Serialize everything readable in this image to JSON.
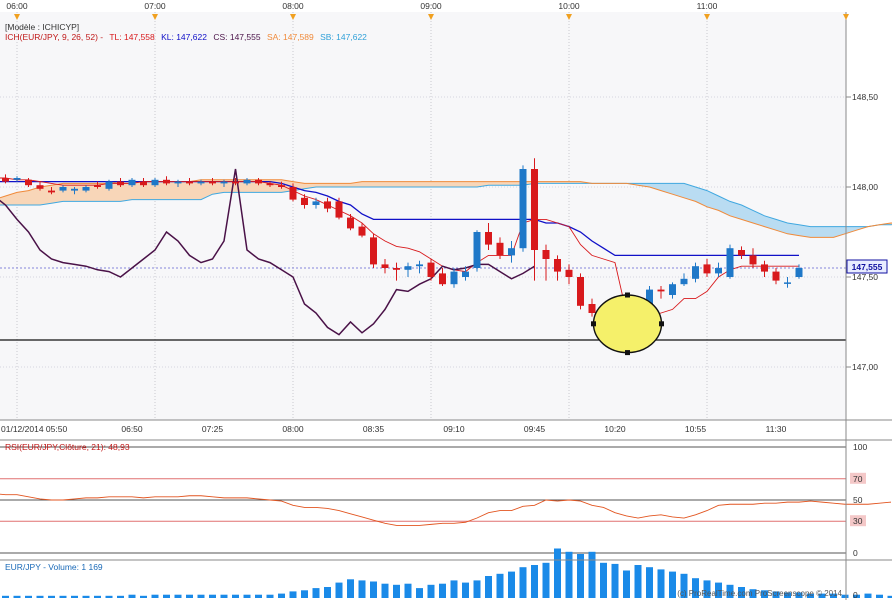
{
  "colors": {
    "bull": "#1f78c8",
    "bear": "#d8191c",
    "tenkan": "#d8191c",
    "kijun": "#1010c8",
    "chikou": "#4a1248",
    "senkou_a": "#f08a3a",
    "senkou_b": "#40a8e0",
    "kumo_fill": "#b9dcf2",
    "kumo_fill_alt": "#f8d6b8",
    "highlight": "#f5f06a",
    "rsi_line": "#e25520",
    "volume": "#1a8ae8",
    "last_price_tag": "#1010a0"
  },
  "price_panel": {
    "model_label": "[Modèle : ICHICYP]",
    "legend": {
      "prefix": "ICH(EUR/JPY, 9, 26, 52) -",
      "tl": "TL: 147,558",
      "kl": "KL: 147,622",
      "cs": "CS: 147,555",
      "sa": "SA: 147,589",
      "sb": "SB: 147,622"
    },
    "last_price_tag": "147,555"
  },
  "top_time_labels": [
    "06:00",
    "07:00",
    "08:00",
    "09:00",
    "10:00",
    "11:00"
  ],
  "bottom_time_labels": [
    "01/12/2014 05:50",
    "06:50",
    "07:25",
    "08:00",
    "08:35",
    "09:10",
    "09:45",
    "10:20",
    "10:55",
    "11:30"
  ],
  "rsi_panel": {
    "legend": "RSI(EUR/JPY,Clôture, 21): 48,93",
    "ticks": [
      "100",
      "70",
      "50",
      "30",
      "0"
    ]
  },
  "volume_panel": {
    "legend": "EUR/JPY - Volume: 1 169",
    "tick": "0",
    "watermark": "(c) ProRealTime.com ProScreenscope © 2014"
  },
  "chart_data": {
    "type": "candlestick",
    "instrument": "EUR/JPY",
    "timeframe_minutes": 5,
    "first_bar": "05:50",
    "last_bar": "11:35",
    "y_axis_ticks": [
      "148,50",
      "148,00",
      "147,50",
      "147,00"
    ],
    "ylim": [
      146.85,
      149.0
    ],
    "support_level": 147.15,
    "candles": [
      {
        "t": "05:50",
        "o": 148.04,
        "h": 148.07,
        "l": 148.02,
        "c": 148.06
      },
      {
        "t": "05:55",
        "o": 148.05,
        "h": 148.07,
        "l": 148.02,
        "c": 148.03
      },
      {
        "t": "06:00",
        "o": 148.04,
        "h": 148.06,
        "l": 148.03,
        "c": 148.05
      },
      {
        "t": "06:05",
        "o": 148.04,
        "h": 148.05,
        "l": 148.0,
        "c": 148.01
      },
      {
        "t": "06:10",
        "o": 148.01,
        "h": 148.03,
        "l": 147.98,
        "c": 147.99
      },
      {
        "t": "06:15",
        "o": 147.98,
        "h": 148.0,
        "l": 147.96,
        "c": 147.97
      },
      {
        "t": "06:20",
        "o": 147.98,
        "h": 148.01,
        "l": 147.97,
        "c": 148.0
      },
      {
        "t": "06:25",
        "o": 147.98,
        "h": 148.0,
        "l": 147.96,
        "c": 147.99
      },
      {
        "t": "06:30",
        "o": 147.98,
        "h": 148.01,
        "l": 147.97,
        "c": 148.0
      },
      {
        "t": "06:35",
        "o": 148.01,
        "h": 148.03,
        "l": 147.99,
        "c": 148.0
      },
      {
        "t": "06:40",
        "o": 147.99,
        "h": 148.04,
        "l": 147.98,
        "c": 148.03
      },
      {
        "t": "06:45",
        "o": 148.03,
        "h": 148.05,
        "l": 148.0,
        "c": 148.01
      },
      {
        "t": "06:50",
        "o": 148.01,
        "h": 148.05,
        "l": 148.0,
        "c": 148.04
      },
      {
        "t": "06:55",
        "o": 148.03,
        "h": 148.05,
        "l": 148.0,
        "c": 148.01
      },
      {
        "t": "07:00",
        "o": 148.01,
        "h": 148.05,
        "l": 148.0,
        "c": 148.04
      },
      {
        "t": "07:05",
        "o": 148.04,
        "h": 148.06,
        "l": 148.01,
        "c": 148.02
      },
      {
        "t": "07:10",
        "o": 148.02,
        "h": 148.04,
        "l": 148.0,
        "c": 148.03
      },
      {
        "t": "07:15",
        "o": 148.03,
        "h": 148.05,
        "l": 148.01,
        "c": 148.02
      },
      {
        "t": "07:20",
        "o": 148.02,
        "h": 148.04,
        "l": 148.01,
        "c": 148.03
      },
      {
        "t": "07:25",
        "o": 148.03,
        "h": 148.05,
        "l": 148.01,
        "c": 148.02
      },
      {
        "t": "07:30",
        "o": 148.02,
        "h": 148.04,
        "l": 148.0,
        "c": 148.03
      },
      {
        "t": "07:35",
        "o": 148.03,
        "h": 148.05,
        "l": 148.01,
        "c": 148.02
      },
      {
        "t": "07:40",
        "o": 148.02,
        "h": 148.05,
        "l": 148.01,
        "c": 148.04
      },
      {
        "t": "07:45",
        "o": 148.04,
        "h": 148.05,
        "l": 148.01,
        "c": 148.02
      },
      {
        "t": "07:50",
        "o": 148.02,
        "h": 148.03,
        "l": 148.0,
        "c": 148.01
      },
      {
        "t": "07:55",
        "o": 148.01,
        "h": 148.03,
        "l": 147.99,
        "c": 148.0
      },
      {
        "t": "08:00",
        "o": 148.0,
        "h": 148.02,
        "l": 147.92,
        "c": 147.93
      },
      {
        "t": "08:05",
        "o": 147.94,
        "h": 147.96,
        "l": 147.88,
        "c": 147.9
      },
      {
        "t": "08:10",
        "o": 147.9,
        "h": 147.94,
        "l": 147.88,
        "c": 147.92
      },
      {
        "t": "08:15",
        "o": 147.92,
        "h": 147.94,
        "l": 147.86,
        "c": 147.88
      },
      {
        "t": "08:20",
        "o": 147.92,
        "h": 147.94,
        "l": 147.82,
        "c": 147.83
      },
      {
        "t": "08:25",
        "o": 147.83,
        "h": 147.85,
        "l": 147.76,
        "c": 147.77
      },
      {
        "t": "08:30",
        "o": 147.78,
        "h": 147.8,
        "l": 147.72,
        "c": 147.73
      },
      {
        "t": "08:35",
        "o": 147.72,
        "h": 147.74,
        "l": 147.55,
        "c": 147.57
      },
      {
        "t": "08:40",
        "o": 147.57,
        "h": 147.6,
        "l": 147.52,
        "c": 147.55
      },
      {
        "t": "08:45",
        "o": 147.55,
        "h": 147.58,
        "l": 147.48,
        "c": 147.54
      },
      {
        "t": "08:50",
        "o": 147.54,
        "h": 147.58,
        "l": 147.5,
        "c": 147.56
      },
      {
        "t": "08:55",
        "o": 147.56,
        "h": 147.59,
        "l": 147.52,
        "c": 147.57
      },
      {
        "t": "09:00",
        "o": 147.58,
        "h": 147.6,
        "l": 147.48,
        "c": 147.5
      },
      {
        "t": "09:05",
        "o": 147.52,
        "h": 147.55,
        "l": 147.45,
        "c": 147.46
      },
      {
        "t": "09:10",
        "o": 147.46,
        "h": 147.55,
        "l": 147.44,
        "c": 147.53
      },
      {
        "t": "09:15",
        "o": 147.5,
        "h": 147.56,
        "l": 147.48,
        "c": 147.53
      },
      {
        "t": "09:20",
        "o": 147.55,
        "h": 147.76,
        "l": 147.53,
        "c": 147.75
      },
      {
        "t": "09:25",
        "o": 147.75,
        "h": 147.8,
        "l": 147.65,
        "c": 147.68
      },
      {
        "t": "09:30",
        "o": 147.69,
        "h": 147.72,
        "l": 147.6,
        "c": 147.62
      },
      {
        "t": "09:35",
        "o": 147.62,
        "h": 147.7,
        "l": 147.58,
        "c": 147.66
      },
      {
        "t": "09:40",
        "o": 147.66,
        "h": 148.12,
        "l": 147.64,
        "c": 148.1
      },
      {
        "t": "09:45",
        "o": 148.1,
        "h": 148.16,
        "l": 147.48,
        "c": 147.65
      },
      {
        "t": "09:50",
        "o": 147.65,
        "h": 147.68,
        "l": 147.48,
        "c": 147.6
      },
      {
        "t": "09:55",
        "o": 147.6,
        "h": 147.62,
        "l": 147.48,
        "c": 147.53
      },
      {
        "t": "10:00",
        "o": 147.54,
        "h": 147.57,
        "l": 147.46,
        "c": 147.5
      },
      {
        "t": "10:05",
        "o": 147.5,
        "h": 147.52,
        "l": 147.32,
        "c": 147.34
      },
      {
        "t": "10:10",
        "o": 147.35,
        "h": 147.38,
        "l": 147.28,
        "c": 147.3
      },
      {
        "t": "10:15",
        "o": 147.32,
        "h": 147.34,
        "l": 147.16,
        "c": 147.19
      },
      {
        "t": "10:20",
        "o": 147.19,
        "h": 147.24,
        "l": 147.16,
        "c": 147.22
      },
      {
        "t": "10:25",
        "o": 147.22,
        "h": 147.26,
        "l": 147.08,
        "c": 147.18
      },
      {
        "t": "10:30",
        "o": 147.17,
        "h": 147.34,
        "l": 147.15,
        "c": 147.32
      },
      {
        "t": "10:35",
        "o": 147.22,
        "h": 147.45,
        "l": 147.2,
        "c": 147.43
      },
      {
        "t": "10:40",
        "o": 147.43,
        "h": 147.45,
        "l": 147.38,
        "c": 147.42
      },
      {
        "t": "10:45",
        "o": 147.4,
        "h": 147.47,
        "l": 147.38,
        "c": 147.46
      },
      {
        "t": "10:50",
        "o": 147.46,
        "h": 147.52,
        "l": 147.45,
        "c": 147.49
      },
      {
        "t": "10:55",
        "o": 147.49,
        "h": 147.58,
        "l": 147.47,
        "c": 147.56
      },
      {
        "t": "11:00",
        "o": 147.57,
        "h": 147.6,
        "l": 147.5,
        "c": 147.52
      },
      {
        "t": "11:05",
        "o": 147.52,
        "h": 147.58,
        "l": 147.5,
        "c": 147.55
      },
      {
        "t": "11:10",
        "o": 147.5,
        "h": 147.68,
        "l": 147.49,
        "c": 147.66
      },
      {
        "t": "11:15",
        "o": 147.65,
        "h": 147.67,
        "l": 147.6,
        "c": 147.62
      },
      {
        "t": "11:20",
        "o": 147.62,
        "h": 147.66,
        "l": 147.55,
        "c": 147.57
      },
      {
        "t": "11:25",
        "o": 147.57,
        "h": 147.59,
        "l": 147.5,
        "c": 147.53
      },
      {
        "t": "11:30",
        "o": 147.53,
        "h": 147.55,
        "l": 147.46,
        "c": 147.48
      },
      {
        "t": "11:35",
        "o": 147.47,
        "h": 147.5,
        "l": 147.44,
        "c": 147.47
      },
      {
        "t": "11:40",
        "o": 147.5,
        "h": 147.57,
        "l": 147.49,
        "c": 147.55
      }
    ],
    "tenkan": [
      148.05,
      148.05,
      148.04,
      148.04,
      148.03,
      148.02,
      148.01,
      148.01,
      148.01,
      148.01,
      148.02,
      148.02,
      148.02,
      148.03,
      148.03,
      148.03,
      148.03,
      148.03,
      148.03,
      148.03,
      148.03,
      148.03,
      148.03,
      148.03,
      148.02,
      148.01,
      147.98,
      147.95,
      147.93,
      147.9,
      147.87,
      147.84,
      147.8,
      147.74,
      147.7,
      147.67,
      147.66,
      147.64,
      147.6,
      147.56,
      147.54,
      147.53,
      147.58,
      147.62,
      147.62,
      147.62,
      147.8,
      147.82,
      147.82,
      147.8,
      147.78,
      147.68,
      147.62,
      147.6,
      147.58,
      147.3,
      147.25,
      147.28,
      147.3,
      147.32,
      147.38,
      147.38,
      147.42,
      147.5,
      147.54,
      147.56,
      147.56,
      147.56,
      147.56,
      147.56,
      147.56
    ],
    "kijun": [
      148.03,
      148.03,
      148.03,
      148.03,
      148.03,
      148.03,
      148.03,
      148.03,
      148.03,
      148.03,
      148.03,
      148.03,
      148.03,
      148.03,
      148.03,
      148.03,
      148.03,
      148.03,
      148.03,
      148.03,
      148.03,
      148.03,
      148.03,
      148.03,
      148.03,
      148.02,
      148.0,
      147.98,
      147.97,
      147.95,
      147.92,
      147.9,
      147.85,
      147.82,
      147.82,
      147.82,
      147.82,
      147.82,
      147.82,
      147.82,
      147.82,
      147.82,
      147.82,
      147.82,
      147.82,
      147.82,
      147.82,
      147.82,
      147.8,
      147.8,
      147.78,
      147.75,
      147.7,
      147.66,
      147.62,
      147.62,
      147.62,
      147.62,
      147.62,
      147.62,
      147.62,
      147.62,
      147.62,
      147.62,
      147.62,
      147.62,
      147.62,
      147.62,
      147.62,
      147.62,
      147.62
    ],
    "chikou": [
      147.95,
      147.9,
      147.82,
      147.75,
      147.65,
      147.6,
      147.58,
      147.57,
      147.56,
      147.54,
      147.53,
      147.5,
      147.55,
      147.6,
      147.65,
      147.75,
      147.7,
      147.62,
      147.58,
      147.6,
      147.7,
      148.1,
      147.65,
      147.6,
      147.58,
      147.54,
      147.5,
      147.35,
      147.3,
      147.22,
      147.18,
      147.25,
      147.19,
      147.24,
      147.32,
      147.43,
      147.42,
      147.46,
      147.49,
      147.56,
      147.54,
      147.55,
      147.57,
      147.57,
      147.53,
      147.49,
      147.52,
      147.56
    ],
    "senkou_a": [
      147.93,
      147.95,
      147.97,
      147.98,
      148.0,
      148.01,
      148.02,
      148.02,
      148.02,
      148.02,
      148.02,
      148.03,
      148.03,
      148.03,
      148.03,
      148.03,
      148.03,
      148.03,
      148.04,
      148.04,
      148.04,
      148.04,
      148.04,
      148.04,
      148.04,
      148.04,
      148.03,
      148.02,
      148.02,
      148.02,
      148.02,
      148.02,
      148.03,
      148.03,
      148.03,
      148.03,
      148.03,
      148.03,
      148.03,
      148.03,
      148.03,
      148.03,
      148.03,
      148.03,
      148.03,
      148.03,
      148.03,
      148.03,
      148.03,
      148.03,
      148.03,
      148.03,
      148.02,
      148.02,
      148.02,
      148.02,
      148.01,
      148.0,
      147.98,
      147.96,
      147.94,
      147.92,
      147.89,
      147.87,
      147.84,
      147.82,
      147.8,
      147.78,
      147.76,
      147.74,
      147.73,
      147.72,
      147.72,
      147.72,
      147.74,
      147.76,
      147.78,
      147.79,
      147.8,
      147.8,
      147.8,
      147.8,
      147.8,
      147.8,
      147.8,
      147.81,
      147.82,
      147.82,
      147.82,
      147.82,
      147.81,
      147.8,
      147.79,
      147.79,
      147.79,
      147.79
    ],
    "senkou_b": [
      147.9,
      147.9,
      147.9,
      147.9,
      147.9,
      147.91,
      147.92,
      147.92,
      147.92,
      147.92,
      147.92,
      147.92,
      147.93,
      147.93,
      147.93,
      147.93,
      147.93,
      147.93,
      147.93,
      147.96,
      147.97,
      147.97,
      147.97,
      147.97,
      147.97,
      147.97,
      147.98,
      147.99,
      148.0,
      148.0,
      148.0,
      148.0,
      148.0,
      148.0,
      148.0,
      148.0,
      148.0,
      148.0,
      148.0,
      148.0,
      148.0,
      148.0,
      148.0,
      148.01,
      148.01,
      148.01,
      148.01,
      148.02,
      148.02,
      148.02,
      148.02,
      148.02,
      148.02,
      148.02,
      148.02,
      148.02,
      148.02,
      148.02,
      148.02,
      148.02,
      148.02,
      148.0,
      147.98,
      147.95,
      147.92,
      147.9,
      147.87,
      147.84,
      147.82,
      147.8,
      147.79,
      147.78,
      147.78,
      147.78,
      147.78,
      147.78,
      147.78,
      147.79,
      147.79,
      147.8,
      147.8,
      147.8,
      147.8,
      147.8,
      147.8,
      147.81,
      147.82,
      147.82,
      147.82,
      147.82,
      147.81,
      147.8,
      147.79,
      147.79,
      147.79,
      147.79
    ],
    "rsi": [
      56,
      55,
      55,
      53,
      51,
      50,
      50,
      51,
      52,
      52,
      53,
      53,
      53,
      52,
      53,
      53,
      53,
      54,
      54,
      53,
      52,
      52,
      52,
      51,
      50,
      49,
      45,
      43,
      43,
      42,
      40,
      37,
      34,
      31,
      28,
      26,
      26,
      26,
      27,
      28,
      28,
      29,
      33,
      38,
      40,
      40,
      44,
      45,
      50,
      49,
      50,
      49,
      45,
      43,
      38,
      35,
      33,
      35,
      36,
      34,
      33,
      36,
      40,
      45,
      46,
      46,
      46,
      47,
      47,
      48,
      48,
      49,
      48,
      47,
      46,
      46,
      46,
      47,
      48
    ],
    "volume": [
      2,
      2,
      2,
      2,
      2,
      2,
      2,
      2,
      2,
      2,
      2,
      2,
      3,
      2,
      3,
      3,
      3,
      3,
      3,
      3,
      3,
      3,
      3,
      3,
      3,
      4,
      6,
      7,
      9,
      10,
      14,
      17,
      16,
      15,
      13,
      12,
      13,
      9,
      12,
      13,
      16,
      14,
      16,
      20,
      22,
      24,
      28,
      30,
      32,
      45,
      42,
      40,
      42,
      32,
      31,
      25,
      30,
      28,
      26,
      24,
      22,
      18,
      16,
      14,
      12,
      10,
      8,
      7,
      6,
      5,
      5,
      4,
      4,
      4,
      3,
      3,
      4,
      3,
      2
    ],
    "highlight_region": {
      "from": "10:15",
      "to": "10:35",
      "low": 147.08,
      "high": 147.4
    }
  }
}
